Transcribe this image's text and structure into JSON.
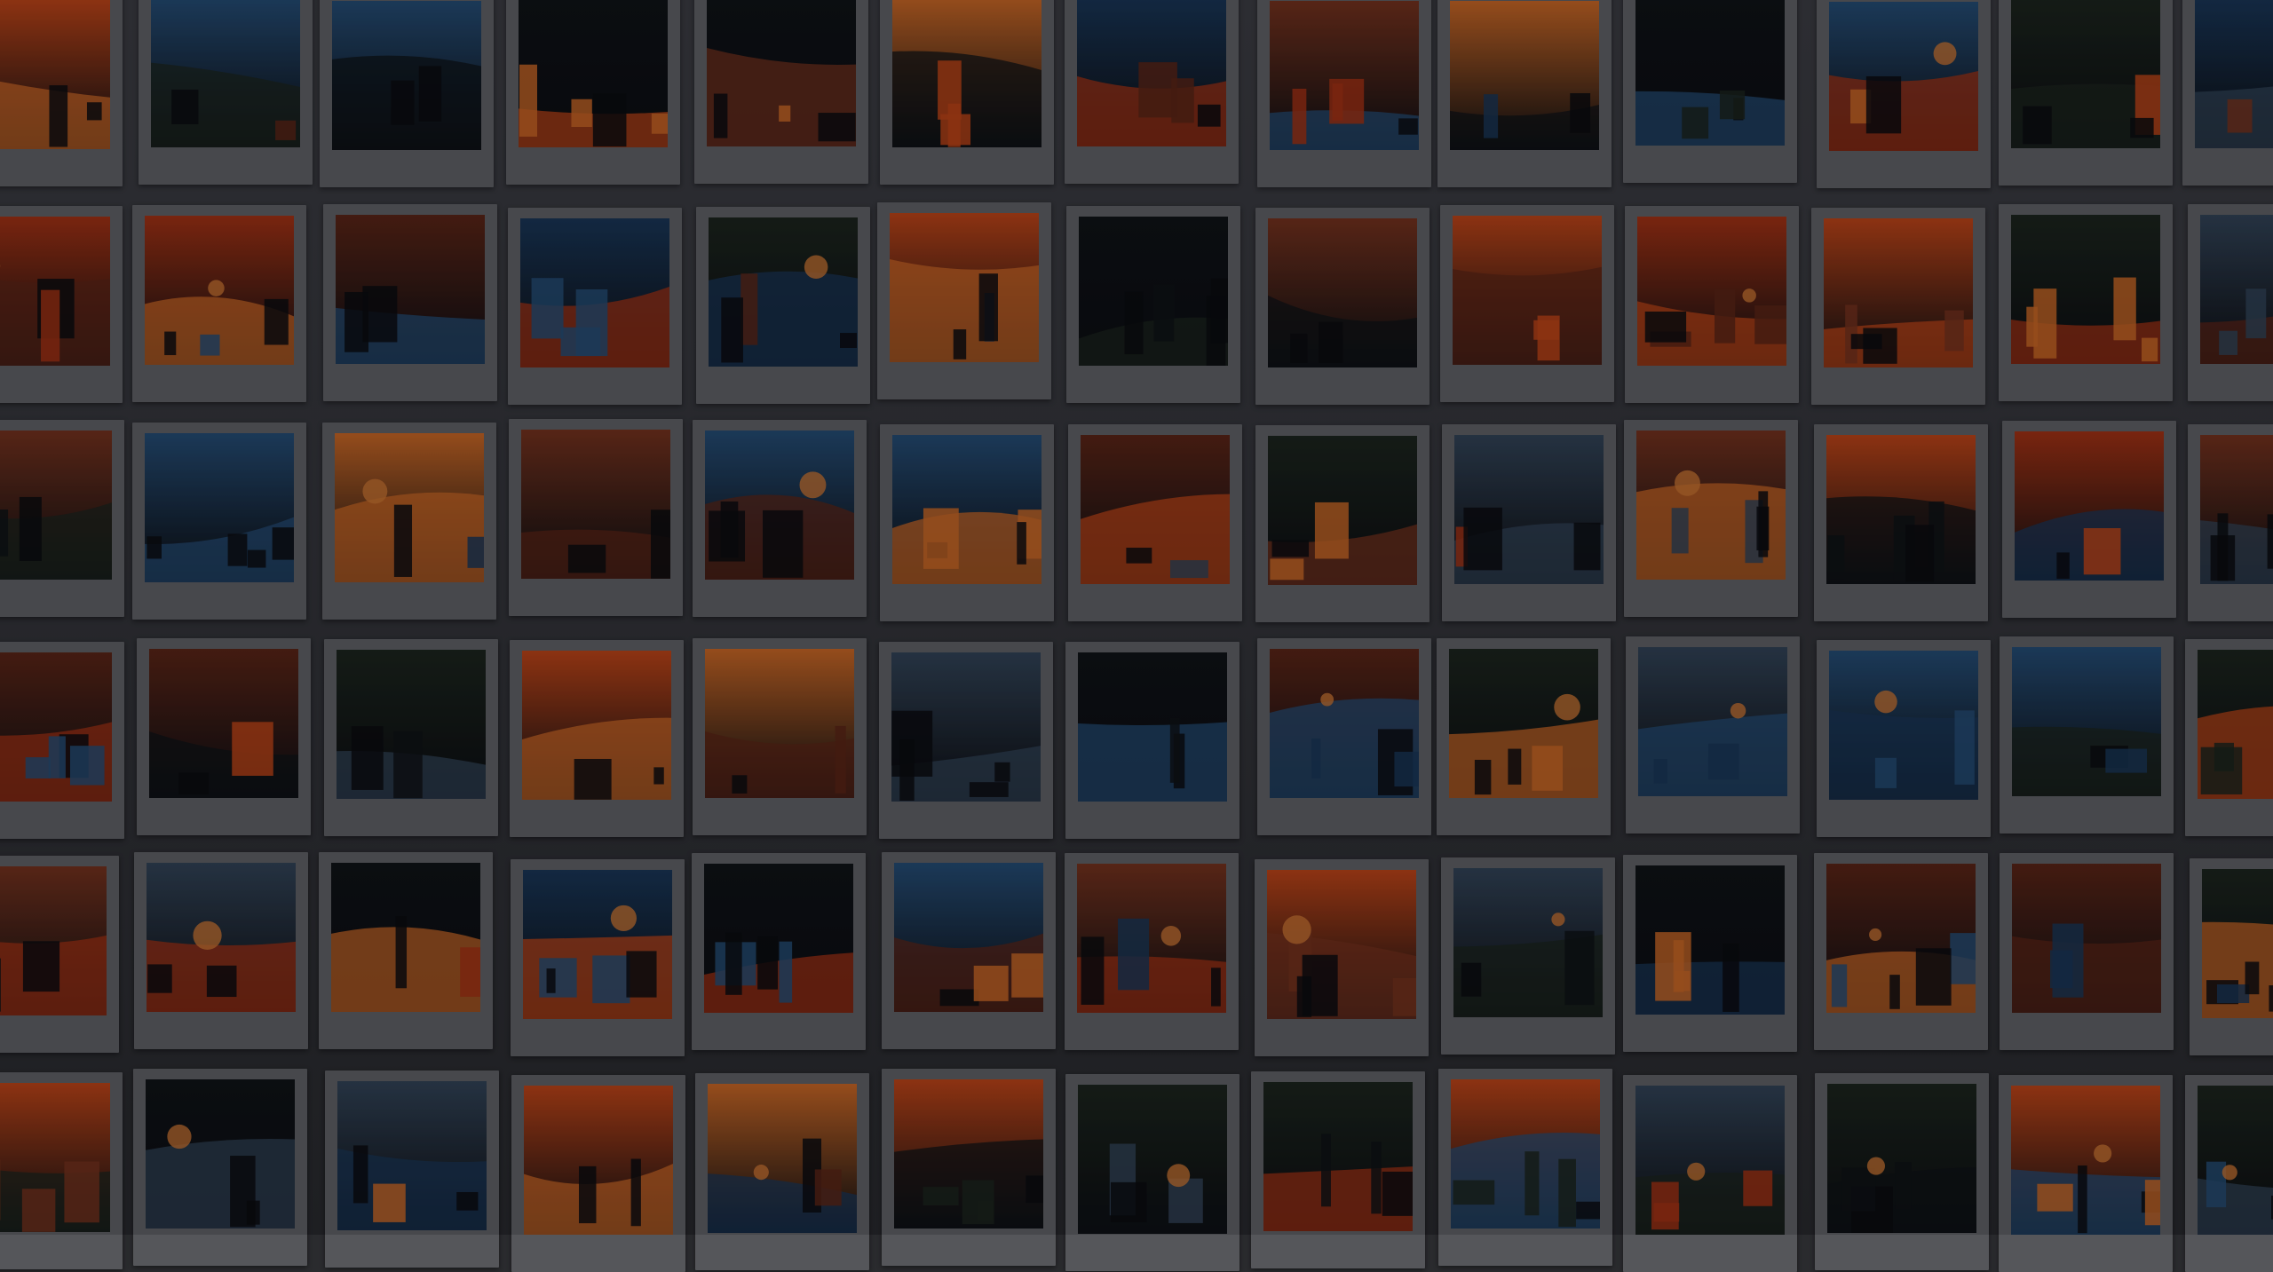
{
  "scene": {
    "subject": "wall-of-instant-photos",
    "rows": 6,
    "columns": 13,
    "tone": "dark-dimmed"
  },
  "palette": {
    "frame": "#55565a",
    "wall": "#2b2c30",
    "accents": [
      "#c23a14",
      "#e2501a",
      "#f07a2a",
      "#1c3f66",
      "#2a5a8a",
      "#1f2a20",
      "#6b2a18",
      "#0f1418",
      "#8a3a20",
      "#3a4f66"
    ]
  },
  "icons": {}
}
